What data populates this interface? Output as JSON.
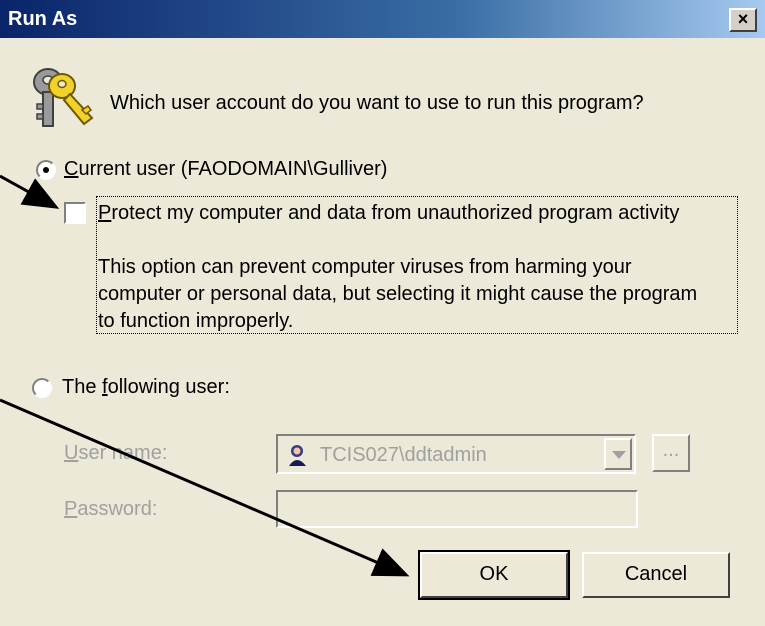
{
  "window": {
    "title": "Run As",
    "close_label": "×"
  },
  "prompt": "Which user account do you want to use to run this program?",
  "current_user": {
    "label_accel": "C",
    "label_rest": "urrent user (FAODOMAIN\\Gulliver)",
    "selected": true
  },
  "protect": {
    "label_accel": "P",
    "label_rest": "rotect my computer and data from unauthorized program activity",
    "checked": false,
    "description": "This option can prevent computer viruses from harming your computer or personal data, but selecting it might cause the program to function improperly."
  },
  "following_user": {
    "label_pre": "The ",
    "label_accel": "f",
    "label_rest": "ollowing user:",
    "selected": false
  },
  "username": {
    "label_accel": "U",
    "label_rest": "ser name:",
    "value": "TCIS027\\ddtadmin",
    "icon": "user-icon",
    "browse_label": "..."
  },
  "password": {
    "label_accel": "P",
    "label_rest": "assword:",
    "value": ""
  },
  "buttons": {
    "ok": "OK",
    "cancel": "Cancel"
  },
  "colors": {
    "title_start": "#0a246a",
    "title_end": "#a6caf0",
    "face": "#ece9d8",
    "disabled_text": "#a0a0a0"
  }
}
